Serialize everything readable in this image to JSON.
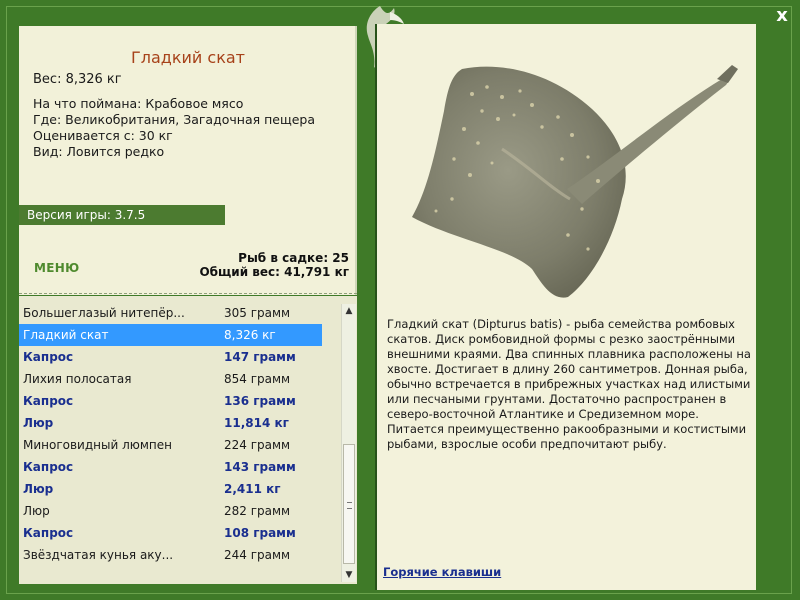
{
  "fish": {
    "title": "Гладкий скат",
    "weight": "Вес: 8,326 кг",
    "bait": "На что поймана: Крабовое мясо",
    "location": "Где: Великобритания, Загадочная пещера",
    "valued": "Оценивается с: 30 кг",
    "kind": "Вид: Ловится редко"
  },
  "version": "Версия игры: 3.7.5",
  "menu_label": "МЕНЮ",
  "totals": {
    "count": "Рыб в садке: 25",
    "weight": "Общий вес: 41,791 кг"
  },
  "catch_list": [
    {
      "name": "Большеглазый нитепёр...",
      "weight": "305 грамм",
      "bold": false,
      "selected": false
    },
    {
      "name": "Гладкий скат",
      "weight": "8,326 кг",
      "bold": false,
      "selected": true
    },
    {
      "name": "Капрос",
      "weight": "147 грамм",
      "bold": true,
      "selected": false
    },
    {
      "name": "Лихия полосатая",
      "weight": "854 грамм",
      "bold": false,
      "selected": false
    },
    {
      "name": "Капрос",
      "weight": "136 грамм",
      "bold": true,
      "selected": false
    },
    {
      "name": "Люр",
      "weight": "11,814 кг",
      "bold": true,
      "selected": false
    },
    {
      "name": "Миноговидный люмпен",
      "weight": "224 грамм",
      "bold": false,
      "selected": false
    },
    {
      "name": "Капрос",
      "weight": "143 грамм",
      "bold": true,
      "selected": false
    },
    {
      "name": "Люр",
      "weight": "2,411 кг",
      "bold": true,
      "selected": false
    },
    {
      "name": "Люр",
      "weight": "282 грамм",
      "bold": false,
      "selected": false
    },
    {
      "name": "Капрос",
      "weight": "108 грамм",
      "bold": true,
      "selected": false
    },
    {
      "name": "Звёздчатая кунья аку...",
      "weight": "244 грамм",
      "bold": false,
      "selected": false
    }
  ],
  "description": "Гладкий скат (Dipturus batis) - рыба семейства ромбовых скатов. Диск ромбовидной формы с резко заострёнными внешними краями. Два спинных плавника расположены на хвосте. Достигает в длину 260 сантиметров. Донная рыба, обычно встречается в прибрежных участках над илистыми или песчаными грунтами. Достаточно распространен в северо-восточной Атлантике и Средиземном море. Питается преимущественно ракообразными и костистыми рыбами, взрослые особи предпочитают рыбу.",
  "hotkeys_label": "Горячие клавиши",
  "close_label": "x",
  "icons": {
    "close": "close-icon",
    "logo": "fish-logo-icon",
    "scroll_up": "scroll-up-arrow-icon",
    "scroll_down": "scroll-down-arrow-icon"
  },
  "colors": {
    "frame": "#3f7a28",
    "panel": "#f2f1d9",
    "title": "#a7421a",
    "selected_row": "#3399ff",
    "bold_row": "#1a2f8f",
    "version_bar": "#4c7b30"
  }
}
